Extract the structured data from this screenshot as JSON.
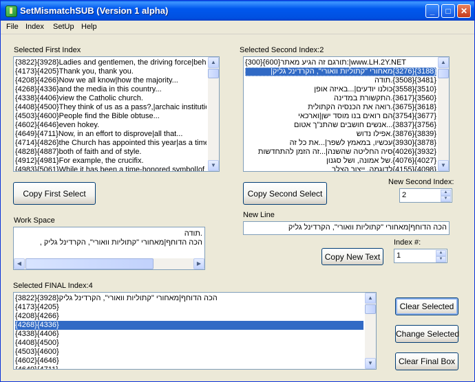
{
  "window": {
    "title": "SetMismatchSUB (Version 1 alpha)",
    "min": "_",
    "max": "□",
    "close": "✕"
  },
  "menu": [
    "File",
    "Index",
    "SetUp",
    "Help"
  ],
  "first": {
    "label": "Selected First Index",
    "items": [
      "{3822}{3928}Ladies and gentlemen, the driving force|behind",
      "{4173}{4205}Thank you, thank you.",
      "{4208}{4266}Now we all know|how the majority...",
      "{4268}{4336}and the media in this country...",
      "{4338}{4406}view the Catholic church.",
      "{4408}{4500}They think of us as a pass?,|archaic institution",
      "{4503}{4600}People find the Bible obtuse...",
      "{4602}{4646}even hokey.",
      "{4649}{4711}Now, in an effort to disprove|all that...",
      "{4714}{4826}the Church has appointed this year|as a time of",
      "{4828}{4887}both of faith and of style.",
      "{4912}{4981}For example, the crucifix.",
      "{4983}{5061}While it has been a time-honored symbol|of our"
    ],
    "copy_button": "Copy First  Select"
  },
  "second": {
    "label": "Selected Second Index:2",
    "items": [
      "{300}{600}תורגם זה הגיע מאתר:|www.LH.2Y.NET",
      "{3188}{3276}מאחורי \"קתוליות וואורי\", הקרדינל גליק|",
      "{3481}{3508}.תודה",
      "{3510}{3558}כולנו יודעים|...באיזה אופן",
      "{3560}{3617}.התקשורת במדינה",
      "{3618}{3675}.רואה את הכנסיה הקתולית",
      "{3677}{3754}הם רואים בנו מוסד ישן|וארכאי",
      "{3756}{3837}...אנשים חושבים שהתנ\"ך אטום",
      "{3839}{3876}.אפילו נדוש",
      "{3878}{3930}עכשיו, במאמץ לשפר|...את כל זה",
      "{3932}{4026}סיה החליטה שהשנה|...זה הזמן להתחדשות",
      "{4027}{4076}.של אמונה, ושל סגנון",
      "{4098}{4155}לדוגמה, ייצור הצלב"
    ],
    "copy_button": "Copy Second Select",
    "new_index_label": "New Second Index:",
    "new_index_value": "2"
  },
  "new_line": {
    "label": "New Line",
    "value": "הכה הדוחף|מאחורי \"קתוליות וואורי\", הקרדינל גליק"
  },
  "index_num": {
    "label": "Index #:",
    "value": "1"
  },
  "copy_new_text": "Copy New Text",
  "workspace": {
    "label": "Work Space",
    "lines": [
      ".תודה",
      "הכה הדוחף|מאחורי \"קתוליות וואורי\", הקרדינל גליק ,"
    ]
  },
  "final": {
    "label": "Selected FINAL Index:4",
    "items": [
      "{3822}{3928}הכה הדוחף|מאחורי \"קתוליות וואורי\", הקרדינל גליק",
      "{4173}{4205}",
      "{4208}{4266}",
      "{4268}{4336}",
      "{4338}{4406}",
      "{4408}{4500}",
      "{4503}{4600}",
      "{4602}{4646}",
      "{4649}{4711}"
    ],
    "buttons": {
      "clear_selected": "Clear Selected",
      "change_selected": "Change Selected",
      "clear_final": "Clear Final Box"
    }
  },
  "icons": {
    "scroll_up": "▲",
    "scroll_down": "▼",
    "scroll_left": "◀",
    "scroll_right": "▶"
  }
}
